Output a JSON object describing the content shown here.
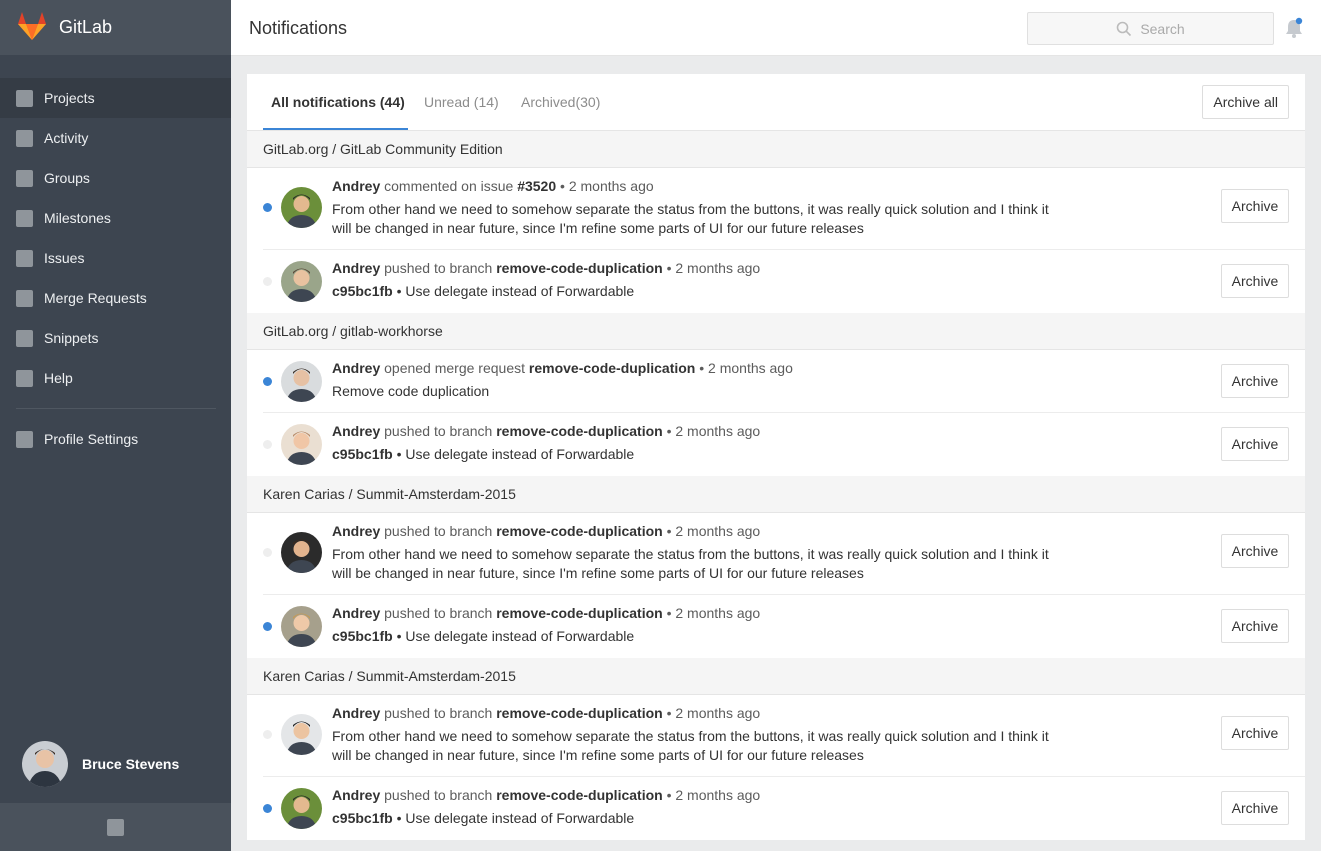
{
  "app": {
    "brand": "GitLab"
  },
  "sidebar": {
    "items": [
      {
        "label": "Projects",
        "active": true
      },
      {
        "label": "Activity"
      },
      {
        "label": "Groups"
      },
      {
        "label": "Milestones"
      },
      {
        "label": "Issues"
      },
      {
        "label": "Merge Requests"
      },
      {
        "label": "Snippets"
      },
      {
        "label": "Help"
      }
    ],
    "profile_settings": "Profile Settings",
    "user_name": "Bruce Stevens"
  },
  "header": {
    "title": "Notifications",
    "search_placeholder": "Search"
  },
  "tabs": {
    "all": "All notifications (44)",
    "unread": "Unread (14)",
    "archived": "Archived(30)",
    "archive_all": "Archive all"
  },
  "groups": [
    {
      "title": "GitLab.org / GitLab Community Edition",
      "rows": [
        {
          "unread": true,
          "author": "Andrey",
          "action": " commented on issue ",
          "target": "#3520",
          "time": " • 2 months ago",
          "ref": "",
          "body": "From other hand we need to somehow separate the status from the buttons, it was really quick solution and I think it will be changed in near future, since I'm refine some parts of UI for our future releases",
          "button": "Archive"
        },
        {
          "unread": false,
          "author": "Andrey",
          "action": " pushed to branch ",
          "target": "remove-code-duplication",
          "time": " • 2 months ago",
          "ref": "c95bc1fb",
          "body": " • Use delegate instead of Forwardable",
          "button": "Archive"
        }
      ]
    },
    {
      "title": "GitLab.org / gitlab-workhorse",
      "rows": [
        {
          "unread": true,
          "author": "Andrey",
          "action": " opened merge request ",
          "target": "remove-code-duplication",
          "time": " • 2 months ago",
          "ref": "",
          "body": "Remove code duplication",
          "button": "Archive"
        },
        {
          "unread": false,
          "author": "Andrey",
          "action": " pushed to branch ",
          "target": "remove-code-duplication",
          "time": " • 2 months ago",
          "ref": "c95bc1fb",
          "body": " • Use delegate instead of Forwardable",
          "button": "Archive"
        }
      ]
    },
    {
      "title": "Karen Carias / Summit-Amsterdam-2015",
      "rows": [
        {
          "unread": false,
          "author": "Andrey",
          "action": " pushed to branch ",
          "target": "remove-code-duplication",
          "time": " • 2 months ago",
          "ref": "",
          "body": "From other hand we need to somehow separate the status from the buttons, it was really quick solution and I think it will be changed in near future, since I'm refine some parts of UI for our future releases",
          "button": "Archive"
        },
        {
          "unread": true,
          "author": "Andrey",
          "action": " pushed to branch ",
          "target": "remove-code-duplication",
          "time": " • 2 months ago",
          "ref": "c95bc1fb",
          "body": " • Use delegate instead of Forwardable",
          "button": "Archive"
        }
      ]
    },
    {
      "title": "Karen Carias / Summit-Amsterdam-2015",
      "rows": [
        {
          "unread": false,
          "author": "Andrey",
          "action": " pushed to branch ",
          "target": "remove-code-duplication",
          "time": " • 2 months ago",
          "ref": "",
          "body": "From other hand we need to somehow separate the status from the buttons, it was really quick solution and I think it will be changed in near future, since I'm refine some parts of UI for our future releases",
          "button": "Archive"
        },
        {
          "unread": true,
          "author": "Andrey",
          "action": " pushed to branch ",
          "target": "remove-code-duplication",
          "time": " • 2 months ago",
          "ref": "c95bc1fb",
          "body": " • Use delegate instead of Forwardable",
          "button": "Archive"
        }
      ]
    }
  ],
  "colors": {
    "accent": "#3b85d6",
    "sidebar": "#3d4550",
    "logo_orange": "#e24329"
  },
  "icons": [
    "gitlab-logo-icon",
    "search-icon",
    "bell-icon",
    "nav-square-icon",
    "avatar"
  ]
}
